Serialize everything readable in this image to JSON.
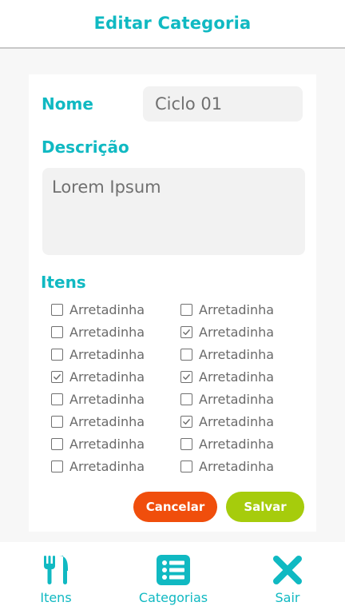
{
  "header": {
    "title": "Editar Categoria"
  },
  "form": {
    "name_label": "Nome",
    "name_value": "Ciclo 01",
    "description_label": "Descrição",
    "description_value": "Lorem Ipsum",
    "items_label": "Itens"
  },
  "items": [
    {
      "label": "Arretadinha",
      "checked": false
    },
    {
      "label": "Arretadinha",
      "checked": false
    },
    {
      "label": "Arretadinha",
      "checked": false
    },
    {
      "label": "Arretadinha",
      "checked": true
    },
    {
      "label": "Arretadinha",
      "checked": false
    },
    {
      "label": "Arretadinha",
      "checked": false
    },
    {
      "label": "Arretadinha",
      "checked": false
    },
    {
      "label": "Arretadinha",
      "checked": false
    },
    {
      "label": "Arretadinha",
      "checked": false
    },
    {
      "label": "Arretadinha",
      "checked": true
    },
    {
      "label": "Arretadinha",
      "checked": false
    },
    {
      "label": "Arretadinha",
      "checked": true
    },
    {
      "label": "Arretadinha",
      "checked": false
    },
    {
      "label": "Arretadinha",
      "checked": true
    },
    {
      "label": "Arretadinha",
      "checked": false
    },
    {
      "label": "Arretadinha",
      "checked": false
    }
  ],
  "actions": {
    "cancel_label": "Cancelar",
    "save_label": "Salvar"
  },
  "nav": {
    "items_label": "Itens",
    "categories_label": "Categorias",
    "exit_label": "Sair"
  },
  "colors": {
    "accent": "#10b9c2",
    "cancel": "#f04e0c",
    "save": "#a6cc0c"
  },
  "icons": {
    "items": "utensils-icon",
    "categories": "list-icon",
    "exit": "close-icon"
  }
}
